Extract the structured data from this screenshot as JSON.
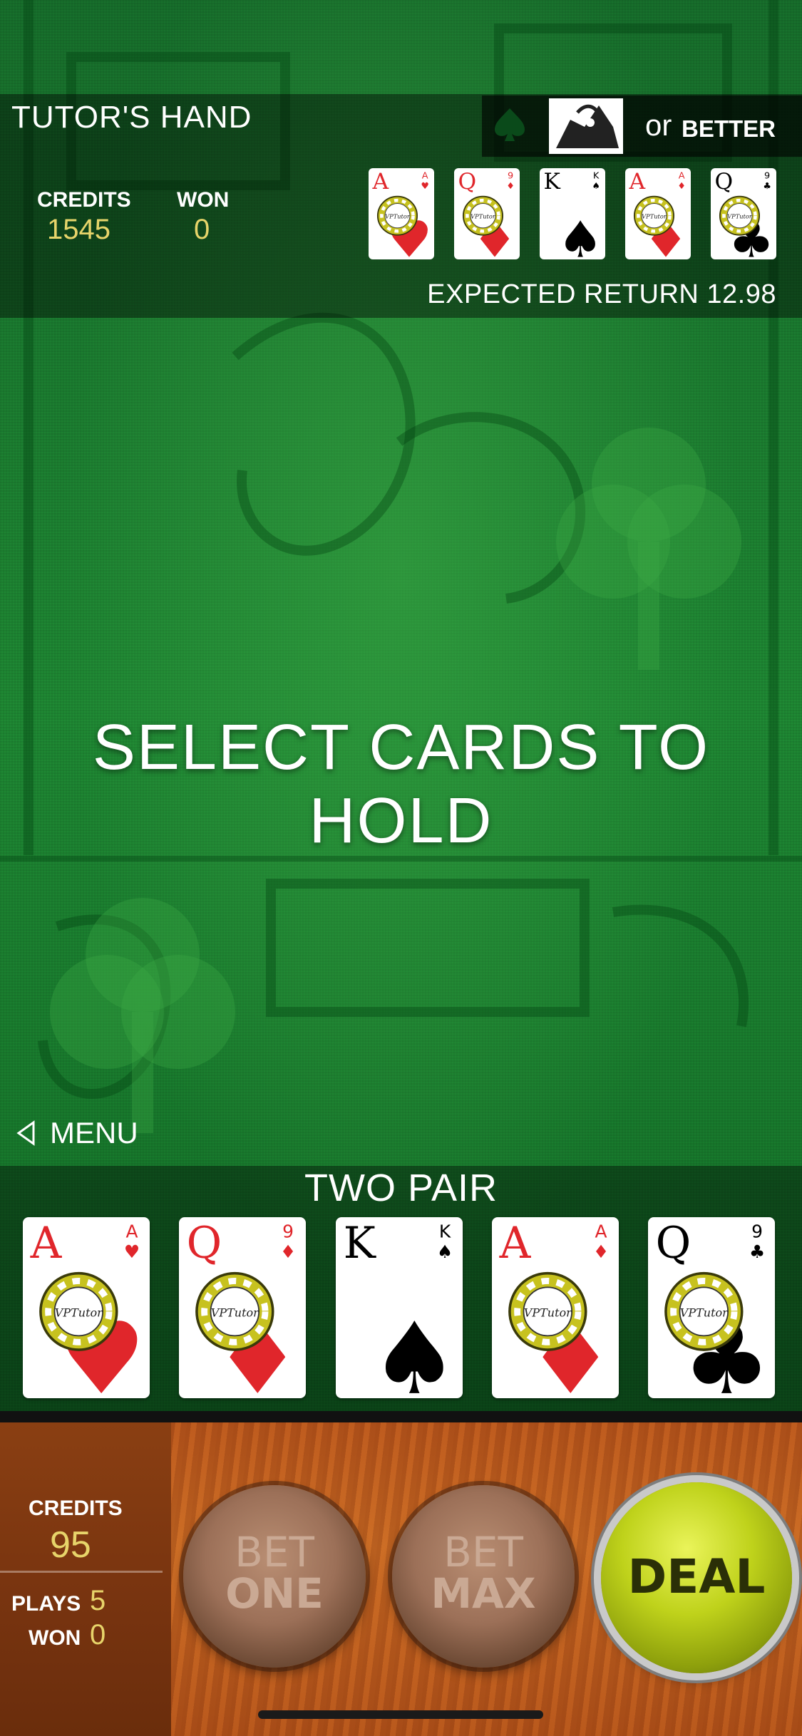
{
  "tutor": {
    "title": "TUTOR'S HAND",
    "game_badge_or": "or",
    "game_badge_better": "BETTER",
    "credits_label": "CREDITS",
    "credits_value": "1545",
    "won_label": "WON",
    "won_value": "0",
    "expected_return_label": "EXPECTED RETURN",
    "expected_return_value": "12.98"
  },
  "cards": [
    {
      "rank": "A",
      "suit": "hearts",
      "suit_symbol": "♥",
      "color": "#e0262b",
      "corner": "A",
      "chip": true
    },
    {
      "rank": "Q",
      "suit": "diamonds",
      "suit_symbol": "♦",
      "color": "#e0262b",
      "corner": "9",
      "chip": true
    },
    {
      "rank": "K",
      "suit": "spades",
      "suit_symbol": "♠",
      "color": "#000000",
      "corner": "K",
      "chip": false
    },
    {
      "rank": "A",
      "suit": "diamonds",
      "suit_symbol": "♦",
      "color": "#e0262b",
      "corner": "A",
      "chip": true
    },
    {
      "rank": "Q",
      "suit": "clubs",
      "suit_symbol": "♣",
      "color": "#000000",
      "corner": "9",
      "chip": true
    }
  ],
  "chip_text": "VPTutor",
  "prompt": "SELECT CARDS TO HOLD",
  "menu_label": "MENU",
  "hand_result": "TWO PAIR",
  "panel": {
    "credits_label": "CREDITS",
    "credits_value": "95",
    "plays_label": "PLAYS",
    "plays_value": "5",
    "won_label": "WON",
    "won_value": "0"
  },
  "buttons": {
    "bet_one_l1": "BET",
    "bet_one_l2": "ONE",
    "bet_max_l1": "BET",
    "bet_max_l2": "MAX",
    "deal": "DEAL"
  },
  "icons": [
    "spade-icon",
    "jack-icon",
    "menu-back-icon",
    "poker-chip-icon"
  ],
  "colors": {
    "felt": "#1f8a34",
    "gold_text": "#e7d46a",
    "deal_green": "#bfd21b",
    "red_suit": "#e0262b"
  }
}
